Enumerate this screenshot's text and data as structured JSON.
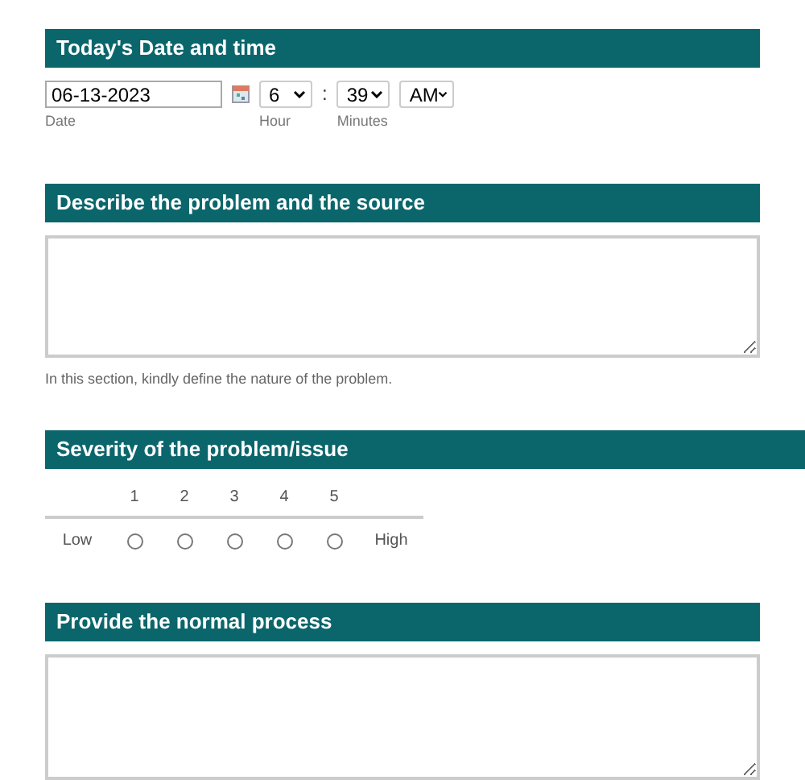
{
  "date_section": {
    "title": "Today's Date and time",
    "date": {
      "value": "06-13-2023",
      "label": "Date"
    },
    "hour": {
      "value": "6",
      "label": "Hour"
    },
    "separator": ":",
    "minutes": {
      "value": "39",
      "label": "Minutes"
    },
    "ampm": {
      "value": "AM"
    }
  },
  "problem_section": {
    "title": "Describe the problem and the source",
    "helper": "In this section, kindly define the nature of the problem."
  },
  "severity_section": {
    "title": "Severity of the problem/issue",
    "low_label": "Low",
    "high_label": "High",
    "options": [
      {
        "label": "1",
        "selected": false
      },
      {
        "label": "2",
        "selected": false
      },
      {
        "label": "3",
        "selected": false
      },
      {
        "label": "4",
        "selected": false
      },
      {
        "label": "5",
        "selected": false
      }
    ]
  },
  "process_section": {
    "title": "Provide the normal process"
  }
}
